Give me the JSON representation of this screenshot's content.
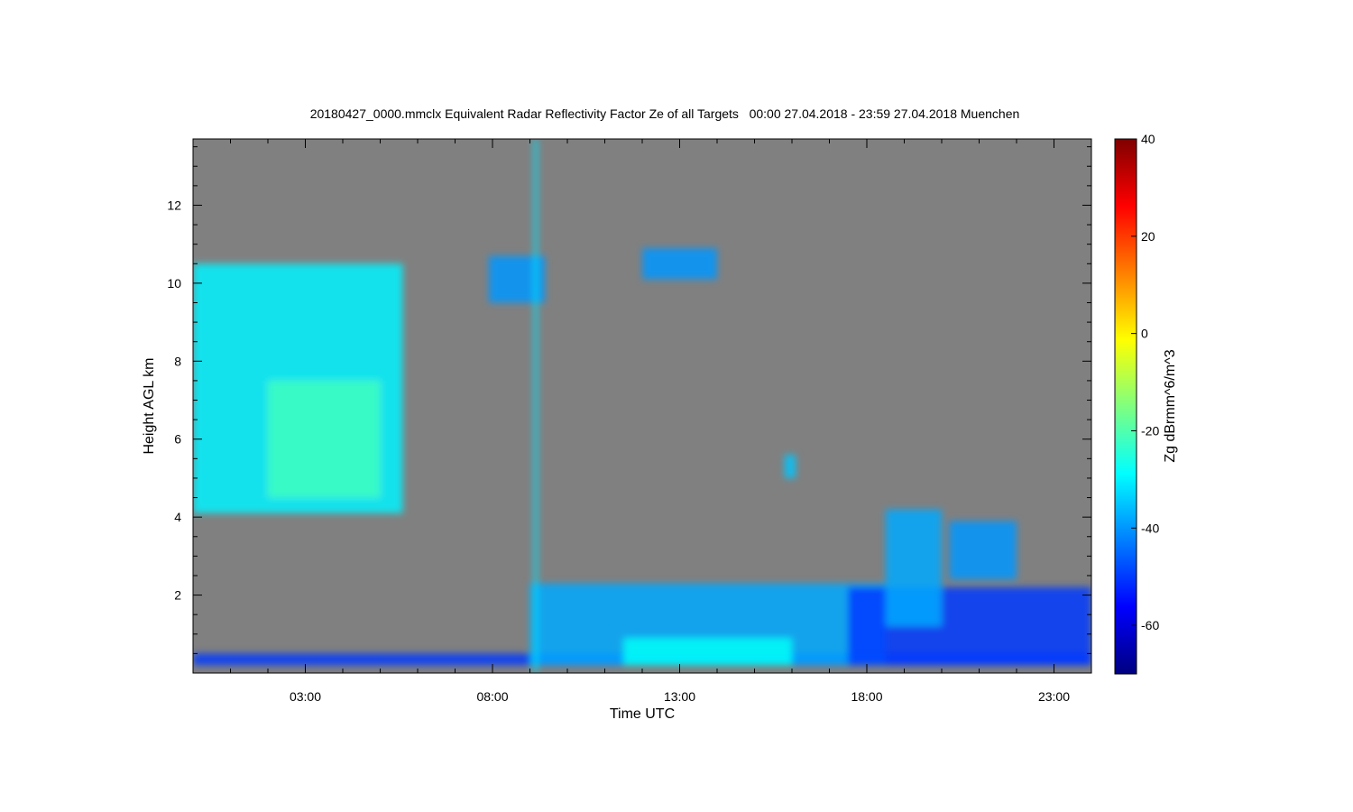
{
  "chart_data": {
    "type": "heatmap",
    "title": "20180427_0000.mmclx Equivalent Radar Reflectivity Factor Ze of all Targets   00:00 27.04.2018 - 23:59 27.04.2018 Muenchen",
    "xlabel": "Time UTC",
    "ylabel": "Height AGL km",
    "colorbar_label": "Zg dBrmm^6/m^3",
    "x_unit": "hours UTC",
    "xlim": [
      0,
      24
    ],
    "ylim": [
      0,
      13.7
    ],
    "clim": [
      -70,
      40
    ],
    "x_ticks": [
      {
        "value": 3,
        "label": "03:00"
      },
      {
        "value": 8,
        "label": "08:00"
      },
      {
        "value": 13,
        "label": "13:00"
      },
      {
        "value": 18,
        "label": "18:00"
      },
      {
        "value": 23,
        "label": "23:00"
      }
    ],
    "y_ticks": [
      {
        "value": 2,
        "label": "2"
      },
      {
        "value": 4,
        "label": "4"
      },
      {
        "value": 6,
        "label": "6"
      },
      {
        "value": 8,
        "label": "8"
      },
      {
        "value": 10,
        "label": "10"
      },
      {
        "value": 12,
        "label": "12"
      }
    ],
    "colorbar_ticks": [
      {
        "value": 40,
        "label": "40"
      },
      {
        "value": 20,
        "label": "20"
      },
      {
        "value": 0,
        "label": "0"
      },
      {
        "value": -20,
        "label": "-20"
      },
      {
        "value": -40,
        "label": "-40"
      },
      {
        "value": -60,
        "label": "-60"
      }
    ],
    "colormap": [
      "#00007f",
      "#0000ff",
      "#007fff",
      "#00ffff",
      "#7fff7f",
      "#ffff00",
      "#ff7f00",
      "#ff0000",
      "#7f0000"
    ],
    "background_color": "#808080",
    "features": [
      {
        "t_start": 0.0,
        "t_end": 5.6,
        "h_bottom": 4.1,
        "h_top": 10.5,
        "ze": -30
      },
      {
        "t_start": 2.0,
        "t_end": 5.0,
        "h_bottom": 4.5,
        "h_top": 7.5,
        "ze": -22
      },
      {
        "t_start": 7.9,
        "t_end": 9.4,
        "h_bottom": 9.5,
        "h_top": 10.7,
        "ze": -40
      },
      {
        "t_start": 12.0,
        "t_end": 14.0,
        "h_bottom": 10.1,
        "h_top": 10.9,
        "ze": -40
      },
      {
        "t_start": 15.8,
        "t_end": 16.1,
        "h_bottom": 5.0,
        "h_top": 5.6,
        "ze": -35
      },
      {
        "t_start": 0.0,
        "t_end": 24.0,
        "h_bottom": 0.2,
        "h_top": 0.5,
        "ze": -50
      },
      {
        "t_start": 9.0,
        "t_end": 18.5,
        "h_bottom": 0.2,
        "h_top": 2.3,
        "ze": -38
      },
      {
        "t_start": 11.5,
        "t_end": 16.0,
        "h_bottom": 0.2,
        "h_top": 0.9,
        "ze": -28
      },
      {
        "t_start": 17.5,
        "t_end": 24.0,
        "h_bottom": 0.2,
        "h_top": 2.2,
        "ze": -50
      },
      {
        "t_start": 18.5,
        "t_end": 20.0,
        "h_bottom": 1.2,
        "h_top": 4.2,
        "ze": -38
      },
      {
        "t_start": 20.2,
        "t_end": 22.0,
        "h_bottom": 2.4,
        "h_top": 3.9,
        "ze": -40
      },
      {
        "t_start": 9.1,
        "t_end": 9.2,
        "h_bottom": 0.0,
        "h_top": 13.7,
        "ze": -32
      }
    ]
  }
}
